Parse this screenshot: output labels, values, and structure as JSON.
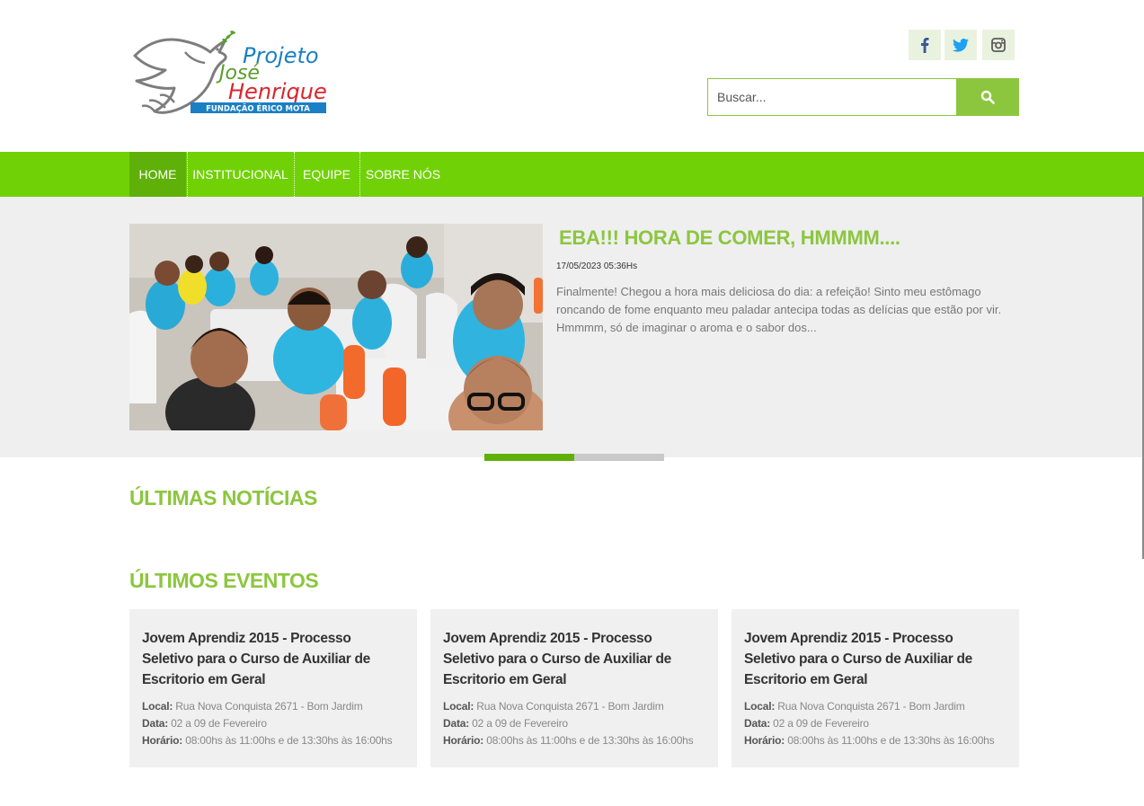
{
  "header": {
    "logo": {
      "line1": "Projeto",
      "line2": "José",
      "line3": "Henrique",
      "subtitle": "FUNDAÇÃO ÉRICO MOTA"
    },
    "social": [
      {
        "name": "facebook",
        "icon": "facebook-icon",
        "glyph": "f"
      },
      {
        "name": "twitter",
        "icon": "twitter-icon"
      },
      {
        "name": "instagram",
        "icon": "instagram-icon"
      }
    ],
    "search": {
      "placeholder": "Buscar...",
      "value": "",
      "button_icon": "search-icon"
    }
  },
  "nav": {
    "items": [
      {
        "label": "HOME",
        "active": true
      },
      {
        "label": "INSTITUCIONAL"
      },
      {
        "label": "EQUIPE"
      },
      {
        "label": "SOBRE NÓS"
      }
    ]
  },
  "slider": {
    "title": "EBA!!! HORA DE COMER, HMMMM....",
    "date": "17/05/2023 05:36Hs",
    "excerpt": "Finalmente! Chegou a hora mais deliciosa do dia: a refeição! Sinto meu estômago roncando de fome enquanto meu paladar antecipa todas as delícias que estão por vir. Hmmmm, só de imaginar o aroma e o sabor dos...",
    "slide_count": 2,
    "active_slide": 1
  },
  "news": {
    "title_light": "ÚLTIMAS ",
    "title_bold": "NOTÍCIAS"
  },
  "events": {
    "title_light": "ÚLTIMOS ",
    "title_bold": "EVENTOS",
    "items": [
      {
        "title": "Jovem Aprendiz 2015 - Processo Seletivo para o Curso de Auxiliar de Escritorio em Geral",
        "local_label": "Local:",
        "local": "Rua Nova Conquista 2671 - Bom Jardim",
        "data_label": "Data:",
        "data": "02 a 09 de Fevereiro",
        "horario_label": "Horário:",
        "horario": "08:00hs às 11:00hs e de 13:30hs às 16:00hs"
      },
      {
        "title": "Jovem Aprendiz 2015 - Processo Seletivo para o Curso de Auxiliar de Escritorio em Geral",
        "local_label": "Local:",
        "local": "Rua Nova Conquista 2671 - Bom Jardim",
        "data_label": "Data:",
        "data": "02 a 09 de Fevereiro",
        "horario_label": "Horário:",
        "horario": "08:00hs às 11:00hs e de 13:30hs às 16:00hs"
      },
      {
        "title": "Jovem Aprendiz 2015 - Processo Seletivo para o Curso de Auxiliar de Escritorio em Geral",
        "local_label": "Local:",
        "local": "Rua Nova Conquista 2671 - Bom Jardim",
        "data_label": "Data:",
        "data": "02 a 09 de Fevereiro",
        "horario_label": "Horário:",
        "horario": "08:00hs às 11:00hs e de 13:30hs às 16:00hs"
      }
    ]
  },
  "colors": {
    "brand_green": "#8cc63f",
    "nav_green": "#71d107",
    "nav_active": "#5fb10a",
    "logo_blue": "#1a7fc4",
    "logo_red": "#d8262c"
  }
}
